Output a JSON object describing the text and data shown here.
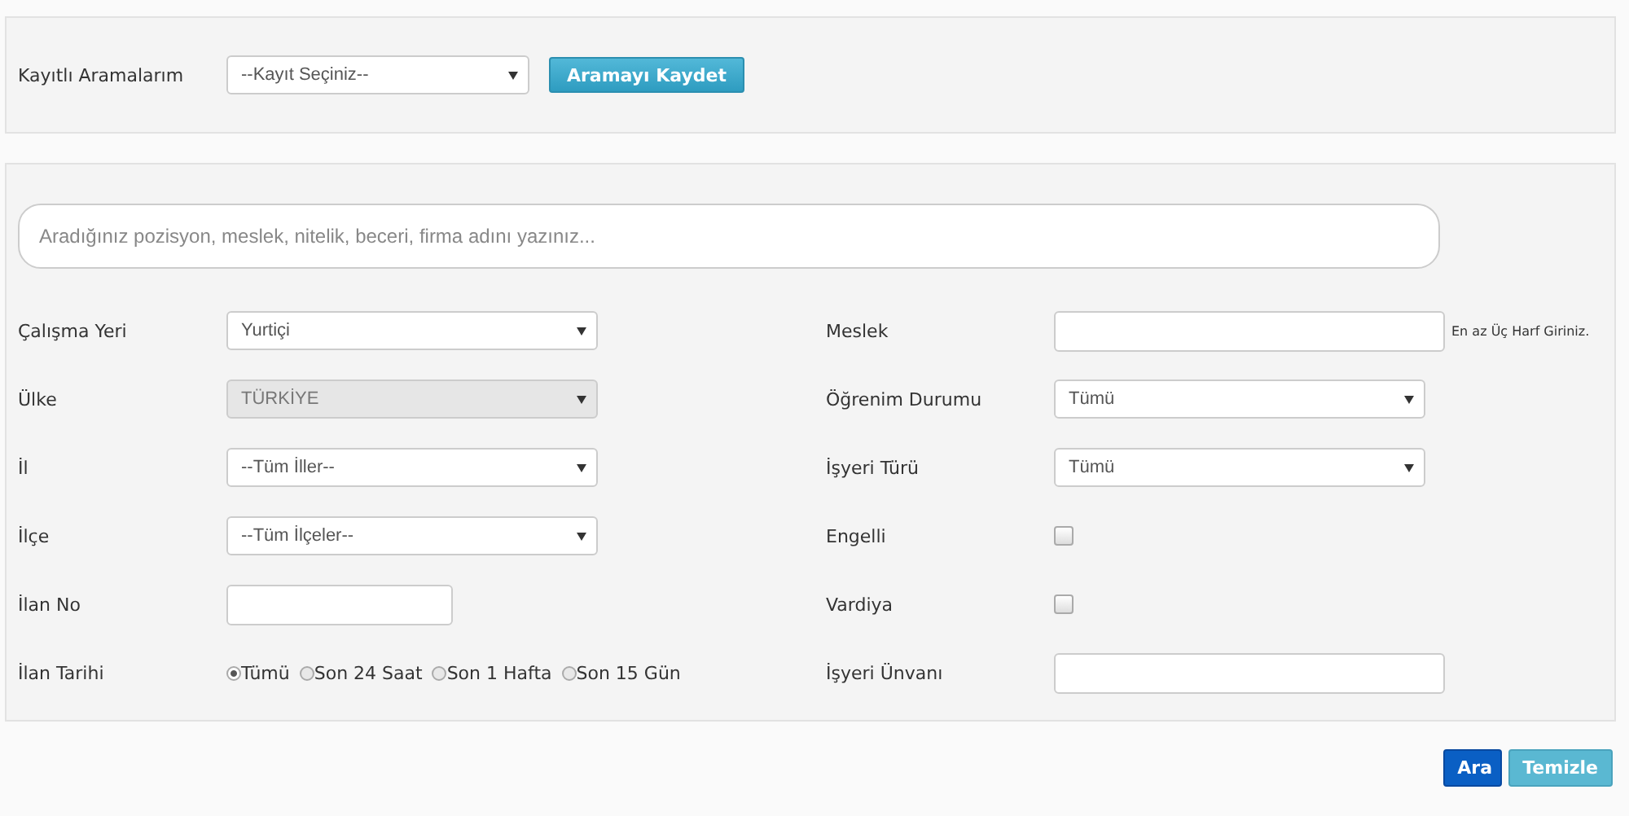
{
  "saved_searches": {
    "label": "Kayıtlı Aramalarım",
    "select_value": "--Kayıt Seçiniz--",
    "save_button": "Aramayı Kaydet"
  },
  "search": {
    "placeholder": "Aradığınız pozisyon, meslek, nitelik, beceri, firma adını yazınız..."
  },
  "left_fields": [
    {
      "kind": "select",
      "label": "Çalışma Yeri",
      "value": "Yurtiçi",
      "disabled": false
    },
    {
      "kind": "select",
      "label": "Ülke",
      "value": "TÜRKİYE",
      "disabled": true
    },
    {
      "kind": "select",
      "label": "İl",
      "value": "--Tüm İller--",
      "disabled": false
    },
    {
      "kind": "select",
      "label": "İlçe",
      "value": "--Tüm İlçeler--",
      "disabled": false
    },
    {
      "kind": "input",
      "label": "İlan No"
    },
    {
      "kind": "radio",
      "label": "İlan Tarihi",
      "options": [
        {
          "label": "Tümü",
          "selected": true
        },
        {
          "label": "Son 24 Saat",
          "selected": false
        },
        {
          "label": "Son 1 Hafta",
          "selected": false
        },
        {
          "label": "Son 15 Gün",
          "selected": false
        }
      ]
    }
  ],
  "right_fields": [
    {
      "kind": "input",
      "label": "Meslek",
      "hint": "En az Üç Harf Giriniz."
    },
    {
      "kind": "select",
      "label": "Öğrenim Durumu",
      "value": "Tümü",
      "disabled": false
    },
    {
      "kind": "select",
      "label": "İşyeri Türü",
      "value": "Tümü",
      "disabled": false
    },
    {
      "kind": "checkbox",
      "label": "Engelli",
      "checked": false
    },
    {
      "kind": "checkbox",
      "label": "Vardiya",
      "checked": false
    },
    {
      "kind": "input",
      "label": "İşyeri Ünvanı"
    }
  ],
  "buttons": [
    {
      "kind": "primary",
      "label": "Ara"
    },
    {
      "kind": "secondary",
      "label": "Temizle"
    }
  ]
}
